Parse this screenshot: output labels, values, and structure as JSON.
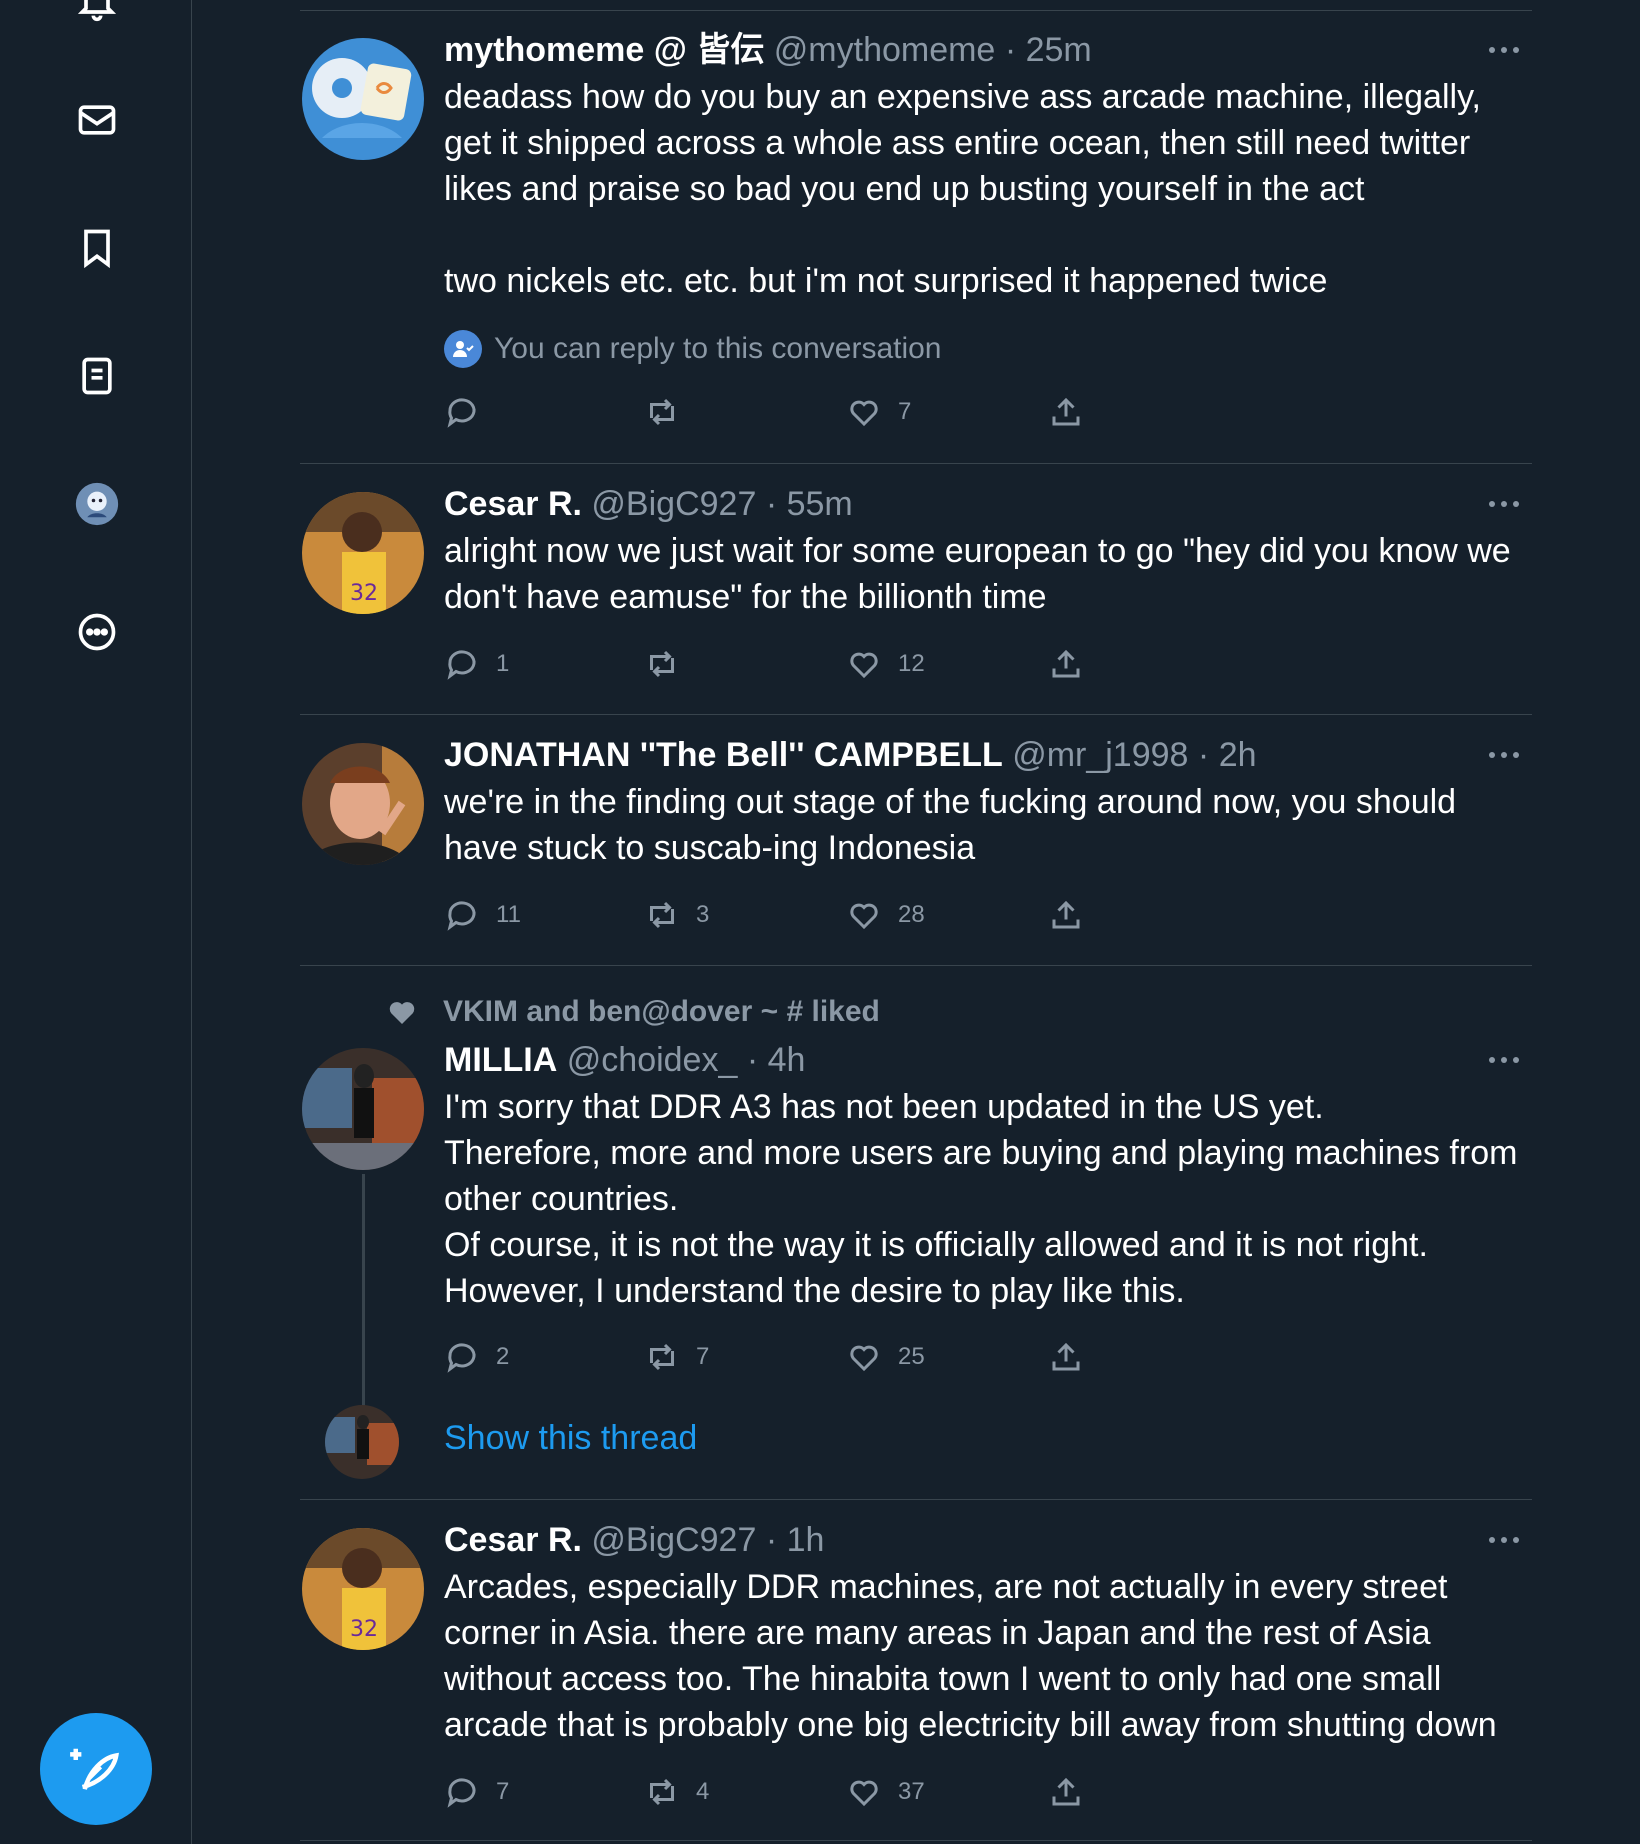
{
  "sidebar": {
    "icons": [
      "notifications-icon",
      "messages-icon",
      "bookmarks-icon",
      "lists-icon",
      "profile-avatar",
      "more-icon"
    ],
    "compose_icon": "compose-tweet-icon"
  },
  "tweets": [
    {
      "name": "mythomeme @ 皆伝",
      "handle": "@mythomeme",
      "dot": "·",
      "time": "25m",
      "text": "deadass how do you buy an expensive ass arcade machine, illegally, get it shipped across a whole ass entire ocean, then still need twitter likes and praise so bad you end up busting yourself in the act\n\ntwo nickels etc. etc. but i'm not surprised it happened twice",
      "reply_note": "You can reply to this conversation",
      "replies": "",
      "retweets": "",
      "likes": "7"
    },
    {
      "name": "Cesar R.",
      "handle": "@BigC927",
      "dot": "·",
      "time": "55m",
      "text": "alright now we just wait for some european to go \"hey did you know we don't have eamuse\" for the billionth time",
      "replies": "1",
      "retweets": "",
      "likes": "12"
    },
    {
      "name": "JONATHAN ''The Bell'' CAMPBELL",
      "handle": "@mr_j1998",
      "dot": "·",
      "time": "2h",
      "text": "we're in the finding out stage of the fucking around now, you should have stuck to suscab-ing Indonesia",
      "replies": "11",
      "retweets": "3",
      "likes": "28"
    },
    {
      "social_context": "VKIM and ben@dover ~ # liked",
      "name": "MILLIA",
      "handle": "@choidex_",
      "dot": "·",
      "time": "4h",
      "text": "I'm sorry that DDR A3 has not been updated in the US yet.\nTherefore, more and more users are buying and playing machines from other countries.\nOf course, it is not the way it is officially allowed and it is not right.\nHowever, I understand the desire to play like this.",
      "replies": "2",
      "retweets": "7",
      "likes": "25",
      "show_thread": "Show this thread"
    },
    {
      "name": "Cesar R.",
      "handle": "@BigC927",
      "dot": "·",
      "time": "1h",
      "text": "Arcades, especially DDR machines, are not actually in every street corner in Asia. there are many areas in Japan and the rest of Asia without access too. The hinabita town I went to only had one small arcade that is probably one big electricity bill away from shutting down",
      "replies": "7",
      "retweets": "4",
      "likes": "37"
    }
  ],
  "colors": {
    "background": "#15202b",
    "divider": "#38444d",
    "secondary_text": "#8b98a5",
    "accent": "#1d9bf0"
  }
}
